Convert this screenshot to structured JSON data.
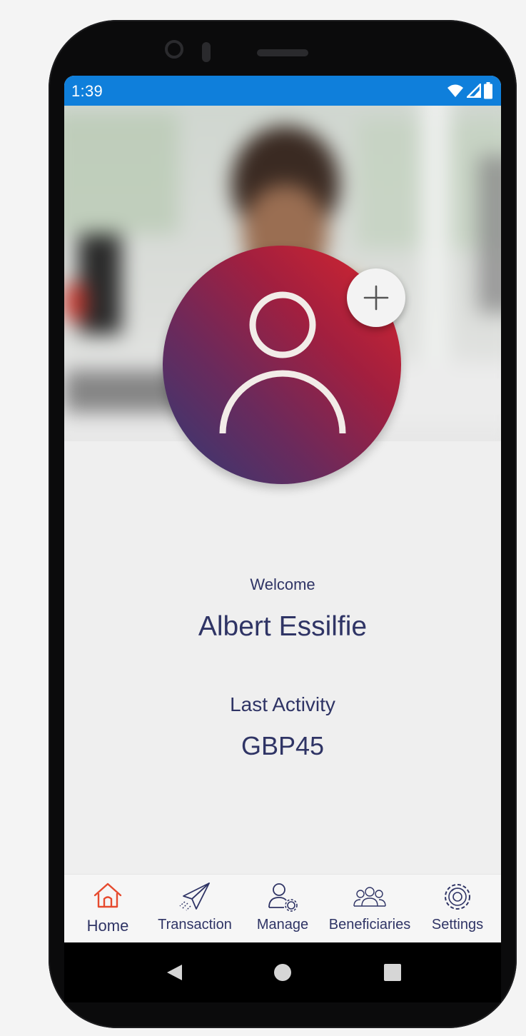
{
  "status_bar": {
    "time": "1:39",
    "icons": [
      "wifi-icon",
      "signal-icon",
      "battery-icon"
    ],
    "color": "#0f7fdb"
  },
  "profile": {
    "welcome_label": "Welcome",
    "user_name": "Albert Essilfie",
    "last_activity_label": "Last Activity",
    "last_activity_value": "GBP45",
    "avatar_gradient": [
      "#313a75",
      "#d9272d"
    ]
  },
  "bottom_nav": {
    "active_color": "#e64a2e",
    "text_color": "#2f3465",
    "items": [
      {
        "label": "Home",
        "icon": "home-icon",
        "active": true
      },
      {
        "label": "Transaction",
        "icon": "paper-plane-icon",
        "active": false
      },
      {
        "label": "Manage",
        "icon": "user-gear-icon",
        "active": false
      },
      {
        "label": "Beneficiaries",
        "icon": "group-icon",
        "active": false
      },
      {
        "label": "Settings",
        "icon": "gear-icon",
        "active": false
      }
    ]
  },
  "system_nav": {
    "buttons": [
      "back-icon",
      "home-circle-icon",
      "recents-icon"
    ]
  }
}
